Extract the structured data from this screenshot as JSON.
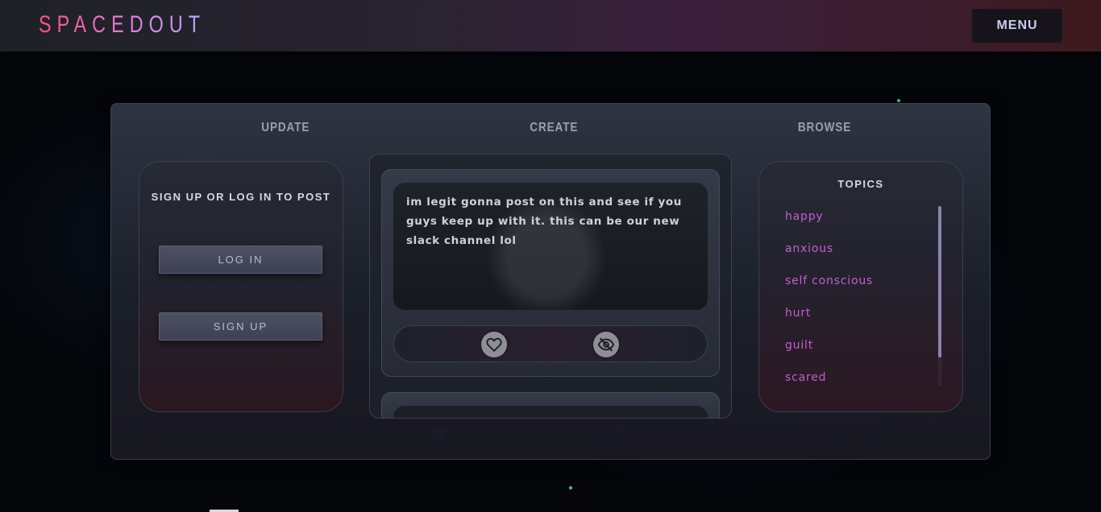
{
  "header": {
    "logo": "SPACEDOUT",
    "menu_label": "MENU"
  },
  "columns": {
    "update": "UPDATE",
    "create": "CREATE",
    "browse": "BROWSE"
  },
  "auth": {
    "title": "SIGN UP OR LOG IN TO POST",
    "login_label": "LOG IN",
    "signup_label": "SIGN UP"
  },
  "post": {
    "text": "im legit gonna post on this and see if you guys keep up with it. this can be our new slack channel lol",
    "like_icon": "heart-icon",
    "hide_icon": "eye-off-icon"
  },
  "topics": {
    "title": "TOPICS",
    "items": [
      "happy",
      "anxious",
      "self conscious",
      "hurt",
      "guilt",
      "scared"
    ]
  },
  "colors": {
    "logo_gradient": [
      "#ff4f7e",
      "#e37ad2",
      "#b7a8ff"
    ],
    "topic_text": "#c25fd0",
    "menu_text": "#c7cdf2"
  }
}
